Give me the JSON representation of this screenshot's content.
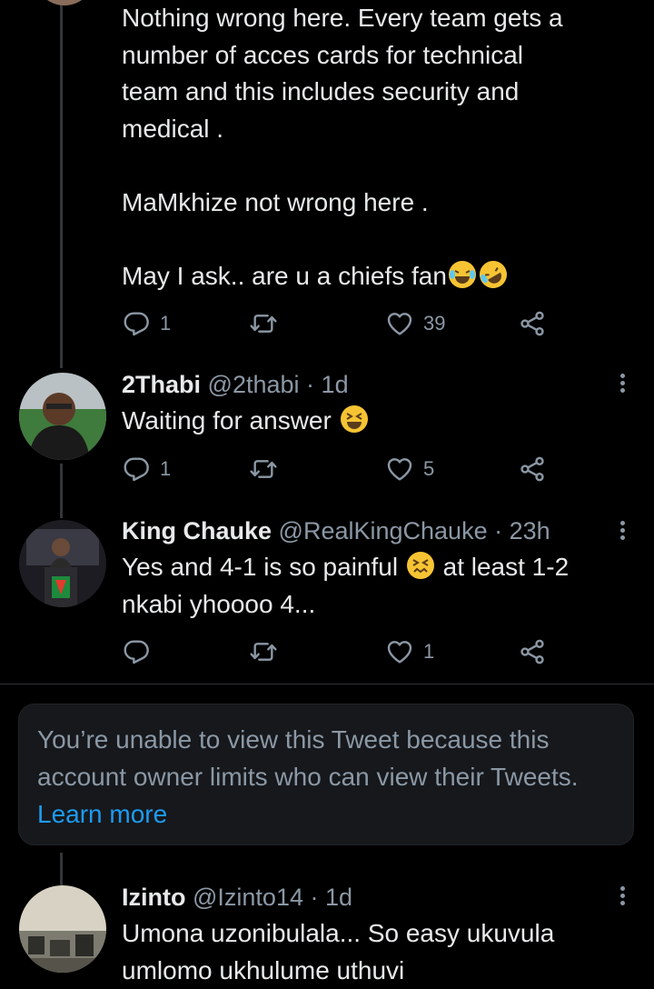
{
  "tweets": [
    {
      "text": "Nothing wrong here. Every team gets a\nnumber of acces cards for technical\nteam and this includes security and\nmedical .\n\nMaMkhize not wrong here .\n\nMay I ask.. are u a chiefs fan",
      "replies": "1",
      "retweets": "",
      "likes": "39"
    },
    {
      "name": "2Thabi",
      "handle": "@2thabi",
      "sep": "·",
      "time": "1d",
      "text": "Waiting for answer",
      "replies": "1",
      "retweets": "",
      "likes": "5"
    },
    {
      "name": "King Chauke",
      "handle": "@RealKingChauke",
      "sep": "·",
      "time": "23h",
      "text_a": "Yes and 4-1 is so painful",
      "text_b": " at least 1-2",
      "text_c": "nkabi yhoooo 4...",
      "replies": "",
      "retweets": "",
      "likes": "1"
    },
    {
      "name": "Izinto",
      "handle": "@Izinto14",
      "sep": "·",
      "time": "1d",
      "text": "Umona uzonibulala... So easy ukuvula\numlomo ukhulume uthuvi"
    }
  ],
  "notice": {
    "text": "You’re unable to view this Tweet because this account owner limits who can view their Tweets. ",
    "link": "Learn more"
  },
  "icons": {
    "reply": "reply-icon",
    "retweet": "retweet-icon",
    "like": "heart-icon",
    "share": "share-icon",
    "more": "more-options-icon"
  },
  "colors": {
    "background": "#000000",
    "text": "#e7e9ea",
    "muted": "#8b98a5",
    "link": "#1d9bf0",
    "emoji": "#f6c433"
  }
}
